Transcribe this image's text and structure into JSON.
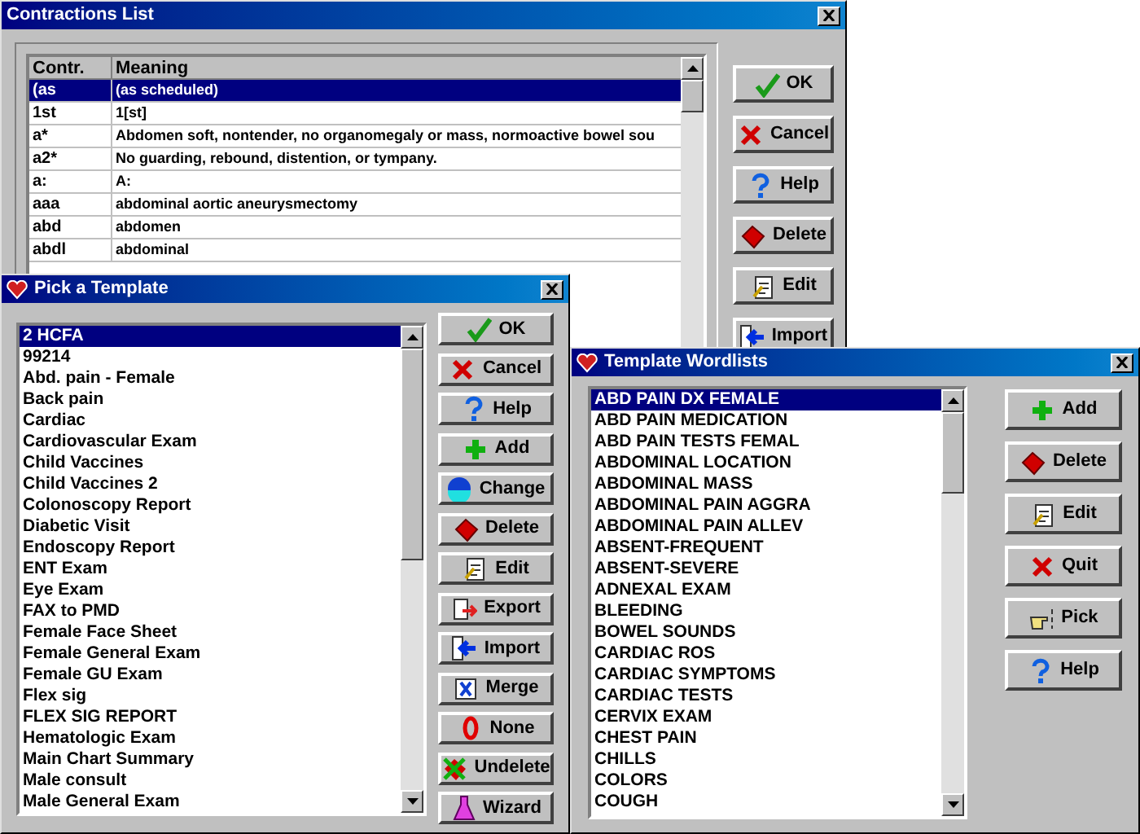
{
  "contractions_window": {
    "title": "Contractions List",
    "table": {
      "columns": [
        "Contr.",
        "Meaning"
      ],
      "rows": [
        {
          "contr": "(as",
          "meaning": "(as scheduled)",
          "selected": true
        },
        {
          "contr": "1st",
          "meaning": "1[st]",
          "selected": false
        },
        {
          "contr": "a*",
          "meaning": "Abdomen soft, nontender, no organomegaly or mass, normoactive bowel sou",
          "selected": false
        },
        {
          "contr": "a2*",
          "meaning": "No guarding, rebound, distention, or tympany.",
          "selected": false
        },
        {
          "contr": "a:",
          "meaning": "A:",
          "selected": false
        },
        {
          "contr": "aaa",
          "meaning": "abdominal aortic aneurysmectomy",
          "selected": false
        },
        {
          "contr": "abd",
          "meaning": "abdomen",
          "selected": false
        },
        {
          "contr": "abdl",
          "meaning": "abdominal",
          "selected": false
        }
      ]
    },
    "buttons": [
      {
        "label": "OK",
        "kind": "check"
      },
      {
        "label": "Cancel",
        "kind": "cross"
      },
      {
        "label": "Help",
        "kind": "question"
      },
      {
        "label": "Delete",
        "kind": "eraser"
      },
      {
        "label": "Edit",
        "kind": "edit"
      },
      {
        "label": "Import",
        "kind": "import"
      }
    ]
  },
  "template_window": {
    "title": "Pick a Template",
    "items": [
      {
        "label": "2 HCFA",
        "selected": true
      },
      {
        "label": "99214",
        "selected": false
      },
      {
        "label": "Abd. pain - Female",
        "selected": false
      },
      {
        "label": "Back pain",
        "selected": false
      },
      {
        "label": "Cardiac",
        "selected": false
      },
      {
        "label": "Cardiovascular Exam",
        "selected": false
      },
      {
        "label": "Child Vaccines",
        "selected": false
      },
      {
        "label": "Child Vaccines 2",
        "selected": false
      },
      {
        "label": "Colonoscopy Report",
        "selected": false
      },
      {
        "label": "Diabetic Visit",
        "selected": false
      },
      {
        "label": "Endoscopy Report",
        "selected": false
      },
      {
        "label": "ENT Exam",
        "selected": false
      },
      {
        "label": "Eye Exam",
        "selected": false
      },
      {
        "label": "FAX to PMD",
        "selected": false
      },
      {
        "label": "Female Face Sheet",
        "selected": false
      },
      {
        "label": "Female General Exam",
        "selected": false
      },
      {
        "label": "Female GU Exam",
        "selected": false
      },
      {
        "label": "Flex sig",
        "selected": false
      },
      {
        "label": "FLEX SIG REPORT",
        "selected": false
      },
      {
        "label": "Hematologic Exam",
        "selected": false
      },
      {
        "label": "Main Chart Summary",
        "selected": false
      },
      {
        "label": "Male consult",
        "selected": false
      },
      {
        "label": "Male General Exam",
        "selected": false
      }
    ],
    "buttons": [
      {
        "label": "OK",
        "kind": "check"
      },
      {
        "label": "Cancel",
        "kind": "cross"
      },
      {
        "label": "Help",
        "kind": "question"
      },
      {
        "label": "Add",
        "kind": "plus"
      },
      {
        "label": "Change",
        "kind": "globe"
      },
      {
        "label": "Delete",
        "kind": "eraser"
      },
      {
        "label": "Edit",
        "kind": "edit"
      },
      {
        "label": "Export",
        "kind": "export"
      },
      {
        "label": "Import",
        "kind": "import"
      },
      {
        "label": "Merge",
        "kind": "merge"
      },
      {
        "label": "None",
        "kind": "zero"
      },
      {
        "label": "Undelete",
        "kind": "undelete"
      },
      {
        "label": "Wizard",
        "kind": "flask"
      }
    ]
  },
  "wordlists_window": {
    "title": "Template Wordlists",
    "items": [
      {
        "label": "ABD PAIN DX FEMALE",
        "selected": true
      },
      {
        "label": "ABD PAIN MEDICATION",
        "selected": false
      },
      {
        "label": "ABD PAIN TESTS FEMAL",
        "selected": false
      },
      {
        "label": "ABDOMINAL LOCATION",
        "selected": false
      },
      {
        "label": "ABDOMINAL MASS",
        "selected": false
      },
      {
        "label": "ABDOMINAL PAIN AGGRA",
        "selected": false
      },
      {
        "label": "ABDOMINAL PAIN ALLEV",
        "selected": false
      },
      {
        "label": "ABSENT-FREQUENT",
        "selected": false
      },
      {
        "label": "ABSENT-SEVERE",
        "selected": false
      },
      {
        "label": "ADNEXAL EXAM",
        "selected": false
      },
      {
        "label": "BLEEDING",
        "selected": false
      },
      {
        "label": "BOWEL SOUNDS",
        "selected": false
      },
      {
        "label": "CARDIAC ROS",
        "selected": false
      },
      {
        "label": "CARDIAC SYMPTOMS",
        "selected": false
      },
      {
        "label": "CARDIAC TESTS",
        "selected": false
      },
      {
        "label": "CERVIX EXAM",
        "selected": false
      },
      {
        "label": "CHEST PAIN",
        "selected": false
      },
      {
        "label": "CHILLS",
        "selected": false
      },
      {
        "label": "COLORS",
        "selected": false
      },
      {
        "label": "COUGH",
        "selected": false
      }
    ],
    "buttons": [
      {
        "label": "Add",
        "kind": "plus"
      },
      {
        "label": "Delete",
        "kind": "eraser"
      },
      {
        "label": "Edit",
        "kind": "edit"
      },
      {
        "label": "Quit",
        "kind": "cross"
      },
      {
        "label": "Pick",
        "kind": "hand"
      },
      {
        "label": "Help",
        "kind": "question"
      }
    ]
  }
}
